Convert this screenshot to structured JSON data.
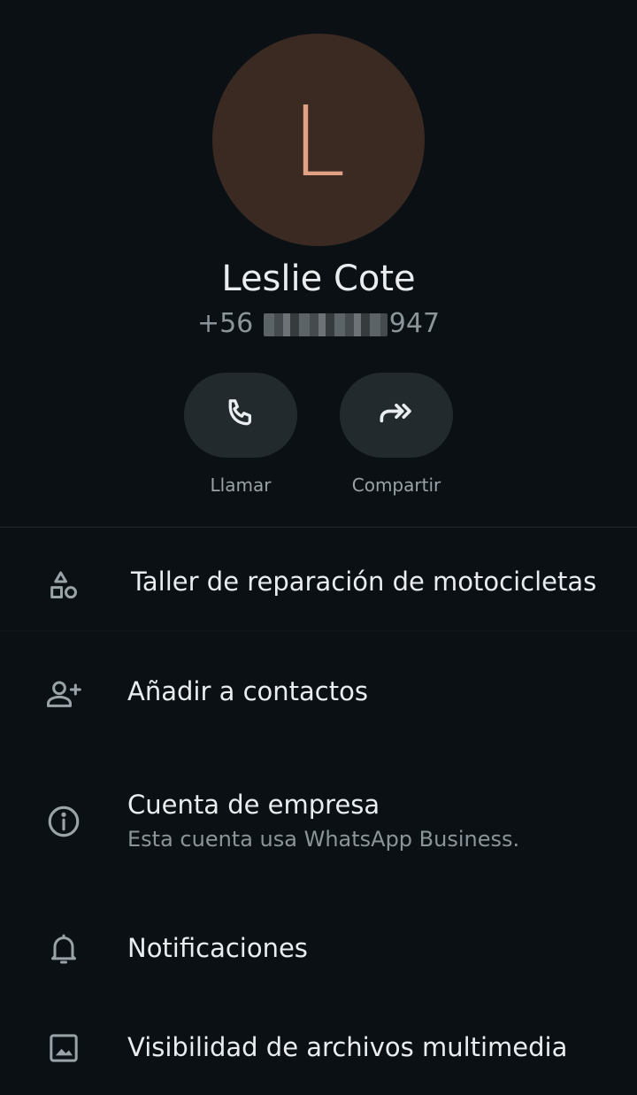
{
  "contact": {
    "initial": "L",
    "name": "Leslie Cote",
    "phone_prefix": "+56",
    "phone_suffix": "947"
  },
  "actions": {
    "call_label": "Llamar",
    "share_label": "Compartir"
  },
  "info": {
    "category": "Taller de reparación de motocicletas",
    "add_contact": "Añadir a contactos",
    "business_title": "Cuenta de empresa",
    "business_subtitle": "Esta cuenta usa WhatsApp Business.",
    "notifications": "Notificaciones",
    "media_visibility": "Visibilidad de archivos multimedia"
  },
  "colors": {
    "background": "#0b1014",
    "avatar_bg": "#3a2a22",
    "avatar_letter": "#e2a184",
    "button_bg": "#232a2e",
    "text_primary": "#e9edef",
    "text_secondary": "#8a9499"
  },
  "icons": {
    "call": "phone-icon",
    "share": "share-forward-icon",
    "category": "shapes-icon",
    "add_contact": "person-add-icon",
    "business": "info-icon",
    "notifications": "bell-icon",
    "media": "image-icon"
  }
}
